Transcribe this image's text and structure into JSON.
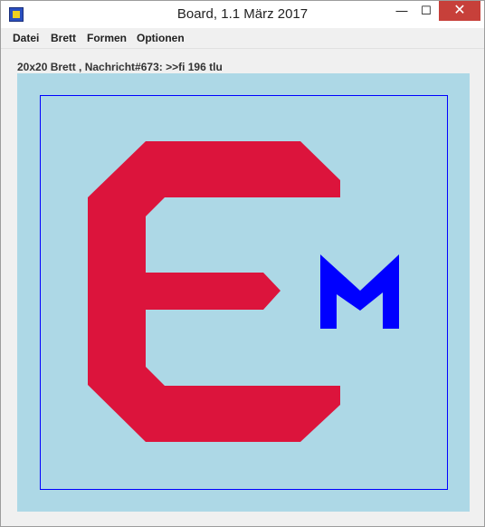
{
  "window": {
    "title": "Board, 1.1 März 2017",
    "controls": {
      "minimize": "—",
      "maximize": "☐",
      "close": "✕"
    }
  },
  "menubar": {
    "items": [
      {
        "label": "Datei"
      },
      {
        "label": "Brett"
      },
      {
        "label": "Formen"
      },
      {
        "label": "Optionen"
      }
    ]
  },
  "status": {
    "text": "20x20 Brett , Nachricht#673: >>fi 196 tlu"
  },
  "board": {
    "background_color": "#add8e6",
    "frame_color": "#0000ff",
    "e_shape_color": "#dc143c",
    "m_shape_color": "#0000ff"
  }
}
